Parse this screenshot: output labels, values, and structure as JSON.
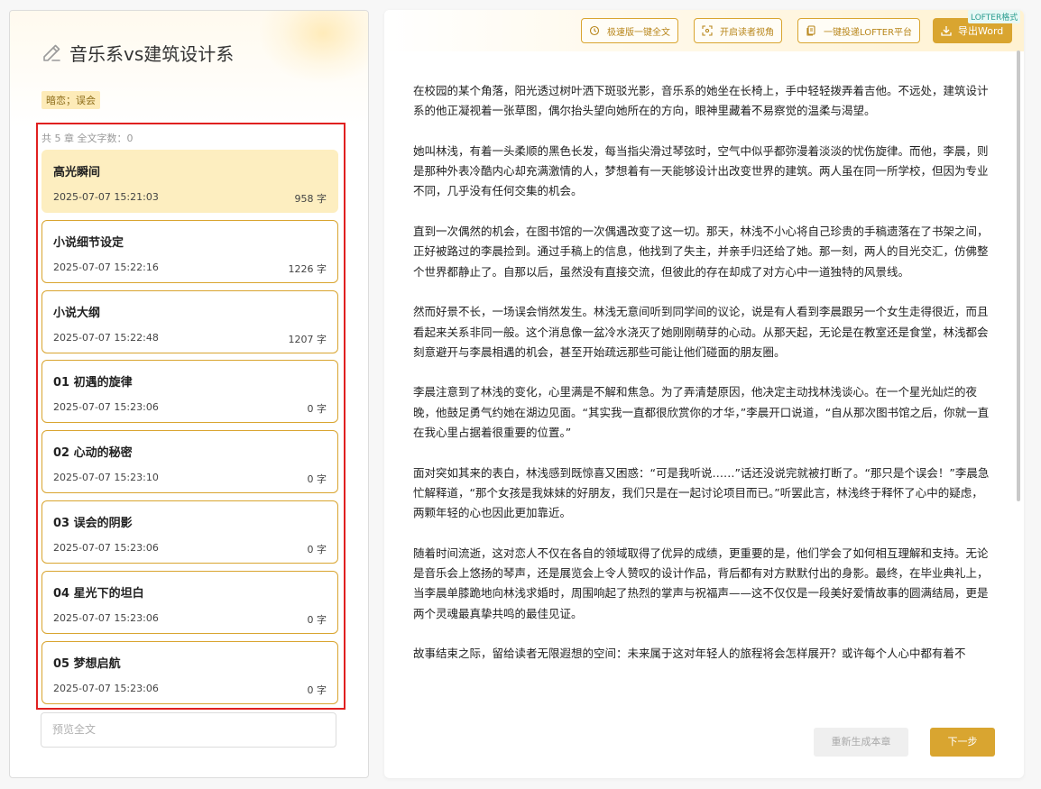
{
  "project": {
    "title": "音乐系vs建筑设计系",
    "tag": "暗恋；误会"
  },
  "chapters": {
    "summary": "共 5 章 全文字数：0",
    "items": [
      {
        "name": "高光瞬间",
        "time": "2025-07-07 15:21:03",
        "count": "958 字",
        "active": true
      },
      {
        "name": "小说细节设定",
        "time": "2025-07-07 15:22:16",
        "count": "1226 字",
        "active": false
      },
      {
        "name": "小说大纲",
        "time": "2025-07-07 15:22:48",
        "count": "1207 字",
        "active": false
      },
      {
        "name": "01 初遇的旋律",
        "time": "2025-07-07 15:23:06",
        "count": "0 字",
        "active": false
      },
      {
        "name": "02 心动的秘密",
        "time": "2025-07-07 15:23:10",
        "count": "0 字",
        "active": false
      },
      {
        "name": "03 误会的阴影",
        "time": "2025-07-07 15:23:06",
        "count": "0 字",
        "active": false
      },
      {
        "name": "04 星光下的坦白",
        "time": "2025-07-07 15:23:06",
        "count": "0 字",
        "active": false
      },
      {
        "name": "05 梦想启航",
        "time": "2025-07-07 15:23:06",
        "count": "0 字",
        "active": false
      }
    ]
  },
  "preview": {
    "placeholder": "预览全文"
  },
  "toolbar": {
    "quick_full": "极速版一键全文",
    "reader_view": "开启读者视角",
    "submit_lofter": "一键投递LOFTER平台",
    "export_word": "导出Word",
    "lofter_badge": "LOFTER格式"
  },
  "content": {
    "paragraphs": [
      "在校园的某个角落，阳光透过树叶洒下斑驳光影，音乐系的她坐在长椅上，手中轻轻拨弄着吉他。不远处，建筑设计系的他正凝视着一张草图，偶尔抬头望向她所在的方向，眼神里藏着不易察觉的温柔与渴望。",
      "她叫林浅，有着一头柔顺的黑色长发，每当指尖滑过琴弦时，空气中似乎都弥漫着淡淡的忧伤旋律。而他，李晨，则是那种外表冷酷内心却充满激情的人，梦想着有一天能够设计出改变世界的建筑。两人虽在同一所学校，但因为专业不同，几乎没有任何交集的机会。",
      "直到一次偶然的机会，在图书馆的一次偶遇改变了这一切。那天，林浅不小心将自己珍贵的手稿遗落在了书架之间，正好被路过的李晨捡到。通过手稿上的信息，他找到了失主，并亲手归还给了她。那一刻，两人的目光交汇，仿佛整个世界都静止了。自那以后，虽然没有直接交流，但彼此的存在却成了对方心中一道独特的风景线。",
      "然而好景不长，一场误会悄然发生。林浅无意间听到同学间的议论，说是有人看到李晨跟另一个女生走得很近，而且看起来关系非同一般。这个消息像一盆冷水浇灭了她刚刚萌芽的心动。从那天起，无论是在教室还是食堂，林浅都会刻意避开与李晨相遇的机会，甚至开始疏远那些可能让他们碰面的朋友圈。",
      "李晨注意到了林浅的变化，心里满是不解和焦急。为了弄清楚原因，他决定主动找林浅谈心。在一个星光灿烂的夜晚，他鼓足勇气约她在湖边见面。“其实我一直都很欣赏你的才华，”李晨开口说道，“自从那次图书馆之后，你就一直在我心里占据着很重要的位置。”",
      "面对突如其来的表白，林浅感到既惊喜又困惑：“可是我听说……”话还没说完就被打断了。“那只是个误会！”李晨急忙解释道，“那个女孩是我妹妹的好朋友，我们只是在一起讨论项目而已。”听罢此言，林浅终于释怀了心中的疑虑，两颗年轻的心也因此更加靠近。",
      "随着时间流逝，这对恋人不仅在各自的领域取得了优异的成绩，更重要的是，他们学会了如何相互理解和支持。无论是音乐会上悠扬的琴声，还是展览会上令人赞叹的设计作品，背后都有对方默默付出的身影。最终，在毕业典礼上，当李晨单膝跪地向林浅求婚时，周围响起了热烈的掌声与祝福声——这不仅仅是一段美好爱情故事的圆满结局，更是两个灵魂最真挚共鸣的最佳见证。",
      "故事结束之际，留给读者无限遐想的空间：未来属于这对年轻人的旅程将会怎样展开？或许每个人心中都有着不"
    ]
  },
  "actions": {
    "regenerate": "重新生成本章",
    "next": "下一步"
  },
  "colors": {
    "accent": "#d9a530",
    "active_chapter_bg": "#fdeec0",
    "highlight_box": "#e02020"
  }
}
